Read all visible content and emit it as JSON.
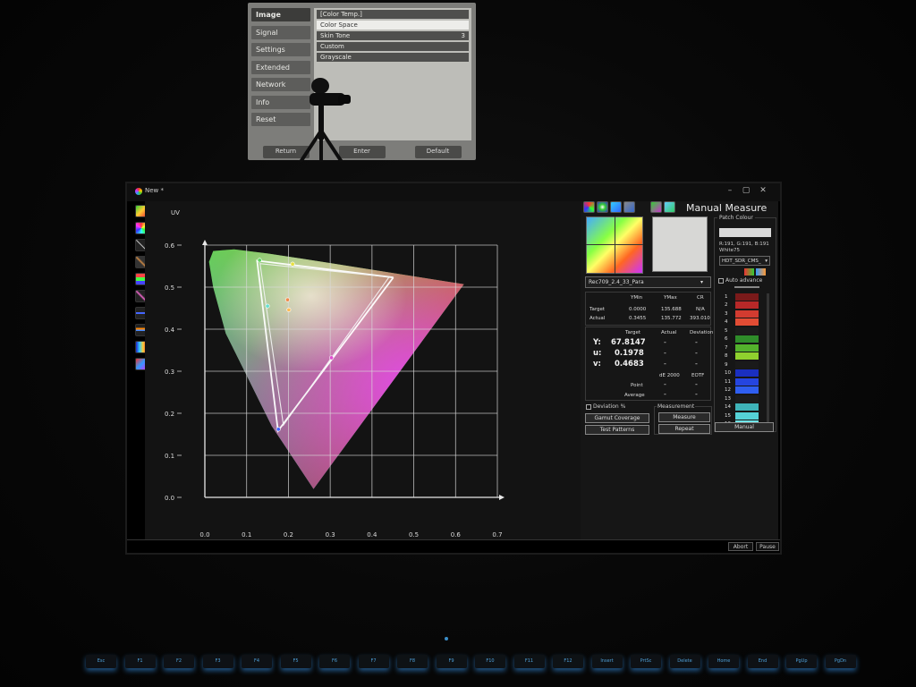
{
  "projection": {
    "menu": [
      "Image",
      "Signal",
      "Settings",
      "Extended",
      "Network",
      "Info",
      "Reset"
    ],
    "submenu": [
      {
        "label": "[Color Temp.]",
        "value": ""
      },
      {
        "label": "Color Space",
        "value": ""
      },
      {
        "label": "Skin Tone",
        "value": "3"
      },
      {
        "label": "Custom",
        "value": ""
      },
      {
        "label": "Grayscale",
        "value": ""
      }
    ],
    "bottom": [
      "Return",
      "Enter",
      "Default"
    ]
  },
  "window": {
    "title": "New *",
    "controls": {
      "minimize": "–",
      "maximize": "▢",
      "close": "✕"
    }
  },
  "toolstrip": {
    "icons": [
      "cie-diagram-icon",
      "palette-icon",
      "gamma-icon",
      "luminance-icon",
      "rgb-balance-icon",
      "saturation-icon",
      "cct-icon",
      "delta-e-icon",
      "spectrum-icon",
      "report-icon"
    ]
  },
  "chart_data": {
    "type": "scatter",
    "title": "",
    "ylabel": "UV",
    "xlabel": "",
    "xlim": [
      0,
      0.7
    ],
    "ylim": [
      0,
      0.6
    ],
    "xticks": [
      "0.0",
      "0.1",
      "0.2",
      "0.3",
      "0.4",
      "0.5",
      "0.6",
      "0.7"
    ],
    "yticks": [
      "0.0",
      "0.1",
      "0.2",
      "0.3",
      "0.4",
      "0.5",
      "0.6"
    ],
    "grid": true,
    "spectral_locus": [
      [
        0.26,
        0.02
      ],
      [
        0.16,
        0.17
      ],
      [
        0.05,
        0.39
      ],
      [
        0.02,
        0.5
      ],
      [
        0.01,
        0.56
      ],
      [
        0.02,
        0.586
      ],
      [
        0.07,
        0.59
      ],
      [
        0.15,
        0.58
      ],
      [
        0.23,
        0.568
      ],
      [
        0.62,
        0.507
      ],
      [
        0.26,
        0.02
      ]
    ],
    "series": [
      {
        "values": [
          [
            0.451,
            0.523
          ],
          [
            0.125,
            0.563
          ],
          [
            0.175,
            0.158
          ],
          [
            0.451,
            0.523
          ]
        ]
      },
      {
        "values": [
          [
            0.441,
            0.524
          ],
          [
            0.132,
            0.556
          ],
          [
            0.188,
            0.172
          ],
          [
            0.441,
            0.524
          ]
        ]
      }
    ],
    "points": [
      {
        "x": 0.21,
        "y": 0.555,
        "color": "#e8e040"
      },
      {
        "x": 0.131,
        "y": 0.564,
        "color": "#5fd35f"
      },
      {
        "x": 0.198,
        "y": 0.47,
        "color": "#f08a4a"
      },
      {
        "x": 0.201,
        "y": 0.446,
        "color": "#ffbb55"
      },
      {
        "x": 0.15,
        "y": 0.455,
        "color": "#66e0d0"
      },
      {
        "x": 0.303,
        "y": 0.332,
        "color": "#e050d0"
      },
      {
        "x": 0.176,
        "y": 0.162,
        "color": "#4060ff"
      }
    ]
  },
  "panel": {
    "title": "Manual Measure",
    "preset": "Rec709_2.4_33_Para",
    "luminance_table": {
      "columns": [
        "YMin",
        "YMax",
        "CR"
      ],
      "rows": [
        {
          "label": "Target",
          "values": [
            "0.0000",
            "135.688",
            "N/A"
          ]
        },
        {
          "label": "Actual",
          "values": [
            "0.3455",
            "135.772",
            "393.010"
          ]
        }
      ]
    },
    "target_table": {
      "columns": [
        "Target",
        "Actual",
        "Deviation"
      ],
      "rows": [
        {
          "label": "Y:",
          "target": "67.8147",
          "actual": "-",
          "deviation": "-"
        },
        {
          "label": "u:",
          "target": "0.1978",
          "actual": "-",
          "deviation": "-"
        },
        {
          "label": "v:",
          "target": "0.4683",
          "actual": "-",
          "deviation": "-"
        }
      ],
      "de_columns": [
        "dE 2000",
        "EOTF"
      ],
      "de_rows": [
        {
          "label": "Point",
          "de": "-",
          "eotf": "-"
        },
        {
          "label": "Average",
          "de": "-",
          "eotf": "-"
        }
      ]
    },
    "deviation_label": "Deviation %",
    "gamut_button": "Gamut Coverage",
    "patterns_button": "Test Patterns",
    "measurement_group": "Measurement",
    "measure_button": "Measure",
    "repeat_button": "Repeat",
    "patch_colour": {
      "title": "Patch Colour",
      "rgb": "R:191, G:191, B:191",
      "name": "White75",
      "selector": "HDT_SDR_CMS_",
      "auto_advance": "Auto advance",
      "patches": [
        {
          "n": "1",
          "color": "#7a1a1a"
        },
        {
          "n": "2",
          "color": "#b72828"
        },
        {
          "n": "3",
          "color": "#d23b30"
        },
        {
          "n": "4",
          "color": "#e24c34"
        },
        {
          "n": "5",
          "color": "#1c1c1c"
        },
        {
          "n": "6",
          "color": "#2f8c2a"
        },
        {
          "n": "7",
          "color": "#53b22c"
        },
        {
          "n": "8",
          "color": "#8fd12e"
        },
        {
          "n": "9",
          "color": "#1a1a1a"
        },
        {
          "n": "10",
          "color": "#1a2fc0"
        },
        {
          "n": "11",
          "color": "#2545e0"
        },
        {
          "n": "12",
          "color": "#2f5ef0"
        },
        {
          "n": "13",
          "color": "#1c1c1c"
        },
        {
          "n": "14",
          "color": "#3fb3b8"
        },
        {
          "n": "15",
          "color": "#55d1d6"
        },
        {
          "n": "16",
          "color": "#6ee6ea"
        }
      ],
      "manual_button": "Manual"
    }
  },
  "status": {
    "abort": "Abort",
    "pause": "Pause"
  },
  "keyboard": {
    "row1": [
      "Esc",
      "F1",
      "F2",
      "F3",
      "F4",
      "F5",
      "F6",
      "F7",
      "F8",
      "F9",
      "F10",
      "F11",
      "F12",
      "Insert",
      "PrtSc",
      "Delete",
      "Home",
      "End",
      "PgUp",
      "PgDn"
    ]
  }
}
